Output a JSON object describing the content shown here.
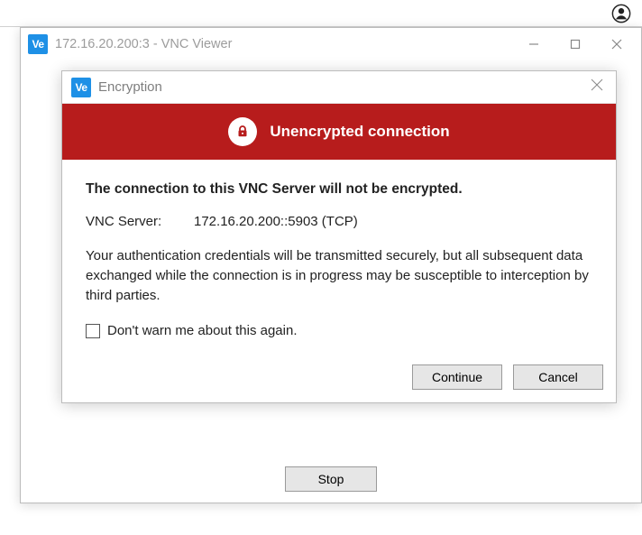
{
  "outer_window": {
    "title": "172.16.20.200:3 - VNC Viewer"
  },
  "dialog": {
    "title": "Encryption",
    "banner": "Unencrypted connection",
    "headline": "The connection to this VNC Server will not be encrypted.",
    "server_label": "VNC Server:",
    "server_value": "172.16.20.200::5903 (TCP)",
    "explanation": "Your authentication credentials will be transmitted securely, but all subsequent data exchanged while the connection is in progress may be susceptible to interception by third parties.",
    "dont_warn_label": "Don't warn me about this again.",
    "continue_label": "Continue",
    "cancel_label": "Cancel"
  },
  "background": {
    "stop_label": "Stop"
  }
}
